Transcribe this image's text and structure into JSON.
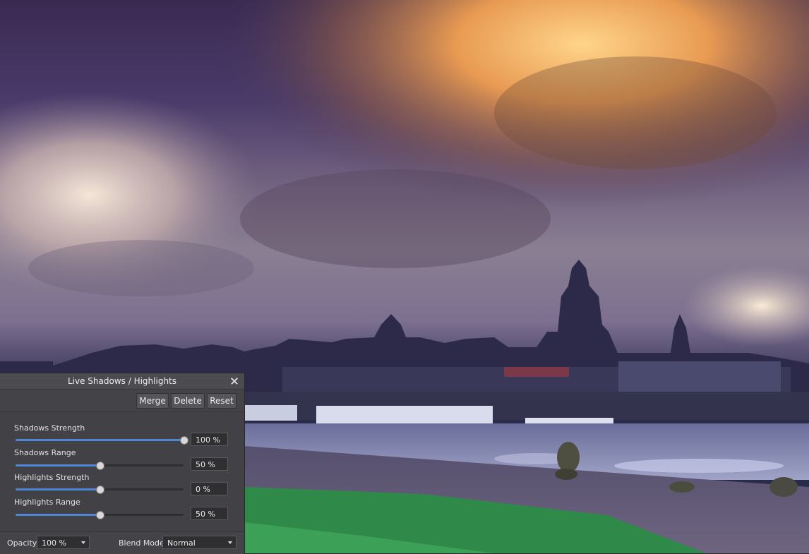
{
  "dialog": {
    "title": "Live Shadows / Highlights",
    "buttons": {
      "merge": "Merge",
      "delete": "Delete",
      "reset": "Reset"
    },
    "params": [
      {
        "label": "Shadows Strength",
        "value": "100 %",
        "level": 1.0
      },
      {
        "label": "Shadows Range",
        "value": "50 %",
        "level": 0.5
      },
      {
        "label": "Highlights Strength",
        "value": "0 %",
        "level": 0.5
      },
      {
        "label": "Highlights Range",
        "value": "50 %",
        "level": 0.5
      }
    ],
    "footer": {
      "opacity_label": "Opacity:",
      "opacity_value": "100 %",
      "blend_label": "Blend Mode:",
      "blend_value": "Normal"
    }
  },
  "colors": {
    "accent": "#4d86d6",
    "panel": "#424246"
  },
  "icons": [
    "close-icon",
    "dropdown-arrow-icon"
  ]
}
